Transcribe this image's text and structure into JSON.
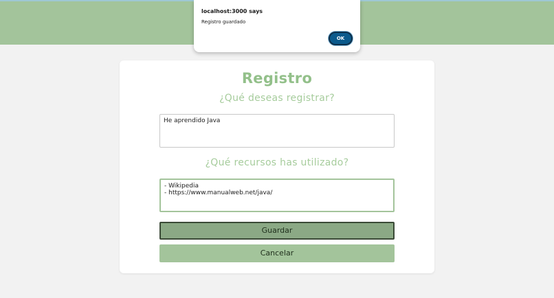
{
  "dialog": {
    "title": "localhost:3000 says",
    "message": "Registro guardado",
    "ok_label": "OK"
  },
  "form": {
    "title": "Registro",
    "question_1": "¿Qué deseas registrar?",
    "answer_1": "He aprendido Java",
    "question_2": "¿Qué recursos has utilizado?",
    "answer_2": "- Wikipedia\n- https://www.manualweb.net/java/",
    "save_label": "Guardar",
    "cancel_label": "Cancelar"
  },
  "colors": {
    "accent_green": "#a3c49b",
    "title_green": "#93c08a",
    "dialog_button": "#0b5a8c"
  }
}
